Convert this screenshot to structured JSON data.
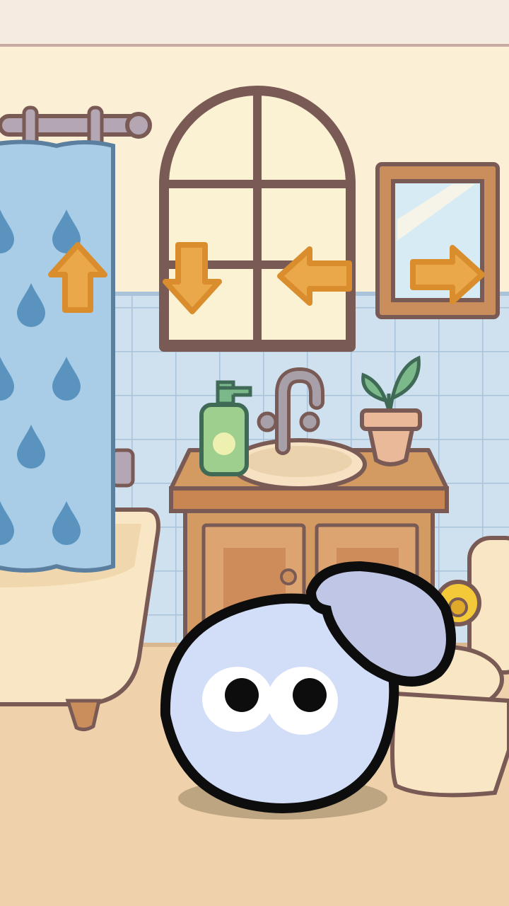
{
  "game": {
    "scene": "bathroom",
    "controls": [
      {
        "direction": "up",
        "icon": "arrow-up-icon"
      },
      {
        "direction": "down",
        "icon": "arrow-down-icon"
      },
      {
        "direction": "left",
        "icon": "arrow-left-icon"
      },
      {
        "direction": "right",
        "icon": "arrow-right-icon"
      }
    ]
  },
  "colors": {
    "wall": "#fbefd6",
    "tile": "#cfe0ee",
    "tile_grout": "#a9c3da",
    "floor": "#efd2ac",
    "outline": "#7a5a55",
    "arrow": "#eba84b",
    "curtain": "#a9cde6",
    "drop": "#5b93bf",
    "wood": "#d39a62",
    "character_body": "#d2ddf7",
    "character_tuft": "#c0c6e6"
  }
}
